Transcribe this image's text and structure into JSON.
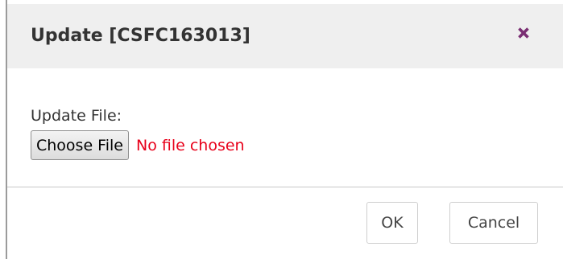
{
  "dialog": {
    "title": "Update [CSFC163013]",
    "close_icon": "close-x-icon",
    "accent_color": "#7a2e73"
  },
  "form": {
    "label": "Update File:",
    "choose_button_label": "Choose File",
    "file_status": "No file chosen",
    "file_status_color": "#e8001a"
  },
  "footer": {
    "ok_label": "OK",
    "cancel_label": "Cancel"
  }
}
